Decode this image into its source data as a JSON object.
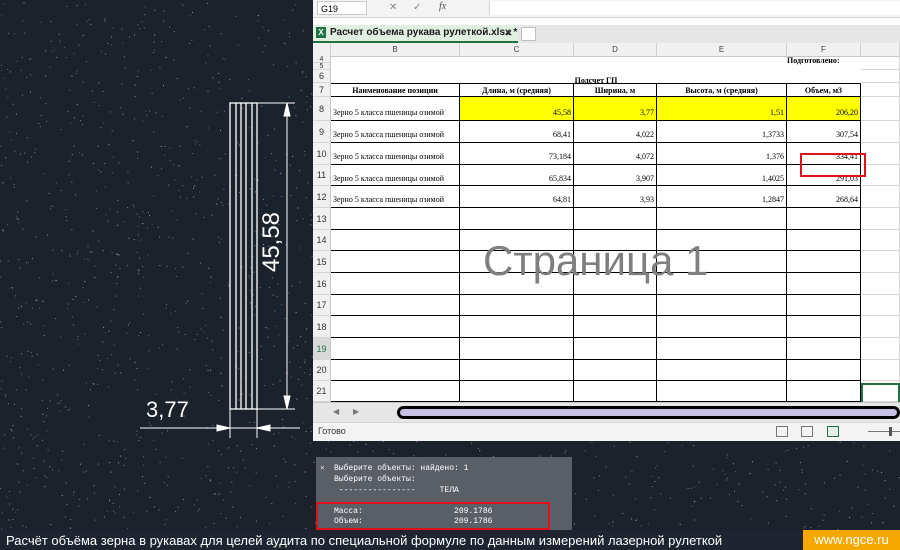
{
  "cad": {
    "dim_length": "45,58",
    "dim_width": "3,77"
  },
  "excel": {
    "name_box": "G19",
    "cancel_icon": "✕",
    "enter_icon": "✓",
    "fx_label": "fx",
    "file_tab": "Расчет объема рукава рулеткой.xlsx *",
    "file_tab_close": "✕",
    "columns": [
      "B",
      "C",
      "D",
      "E",
      "F"
    ],
    "row_numbers": [
      "4",
      "5",
      "6",
      "7",
      "8",
      "9",
      "10",
      "11",
      "12",
      "13",
      "14",
      "15",
      "16",
      "17",
      "18",
      "19",
      "20",
      "21"
    ],
    "prepared_label": "Подготовлено:",
    "table_title": "Подсчет ГП",
    "headers": {
      "name": "Наименование позиции",
      "length": "Длина, м (средняя)",
      "width": "Ширина, м",
      "height": "Высота, м (средняя)",
      "volume": "Объем, м3"
    },
    "rows": [
      {
        "name": "Зерно 5 класса пшеницы озимой",
        "length": "45,58",
        "width": "3,77",
        "height": "1,51",
        "volume": "206,20"
      },
      {
        "name": "Зерно 5 класса пшеницы озимой",
        "length": "68,41",
        "width": "4,022",
        "height": "1,3733",
        "volume": "307,54"
      },
      {
        "name": "Зерно 5 класса пшеницы озимой",
        "length": "73,184",
        "width": "4,072",
        "height": "1,376",
        "volume": "334,41"
      },
      {
        "name": "Зерно 5 класса пшеницы озимой",
        "length": "65,834",
        "width": "3,907",
        "height": "1,4025",
        "volume": "291,03"
      },
      {
        "name": "Зерно 5 класса пшеницы озимой",
        "length": "64,81",
        "width": "3,93",
        "height": "1,2847",
        "volume": "268,64"
      }
    ],
    "page_watermark": "Страница 1",
    "status_ready": "Готово"
  },
  "command_window": {
    "close_icon": "✕",
    "lines": [
      "Выберите объекты: найдено: 1",
      "Выберите объекты:",
      " ----------------     ТЕЛА",
      "Масса:                   209.1786",
      "Объем:                   209.1786"
    ]
  },
  "caption": {
    "text": "Расчёт объёма зерна в рукавах для целей аудита по специальной формуле по данным измерений лазерной рулеткой",
    "brand": "www.ngce.ru"
  },
  "colors": {
    "cad_background": "#1c222b",
    "highlight_yellow": "#ffff00",
    "highlight_red": "#e0111c",
    "excel_green": "#217346",
    "brand_orange": "#f4a800"
  }
}
